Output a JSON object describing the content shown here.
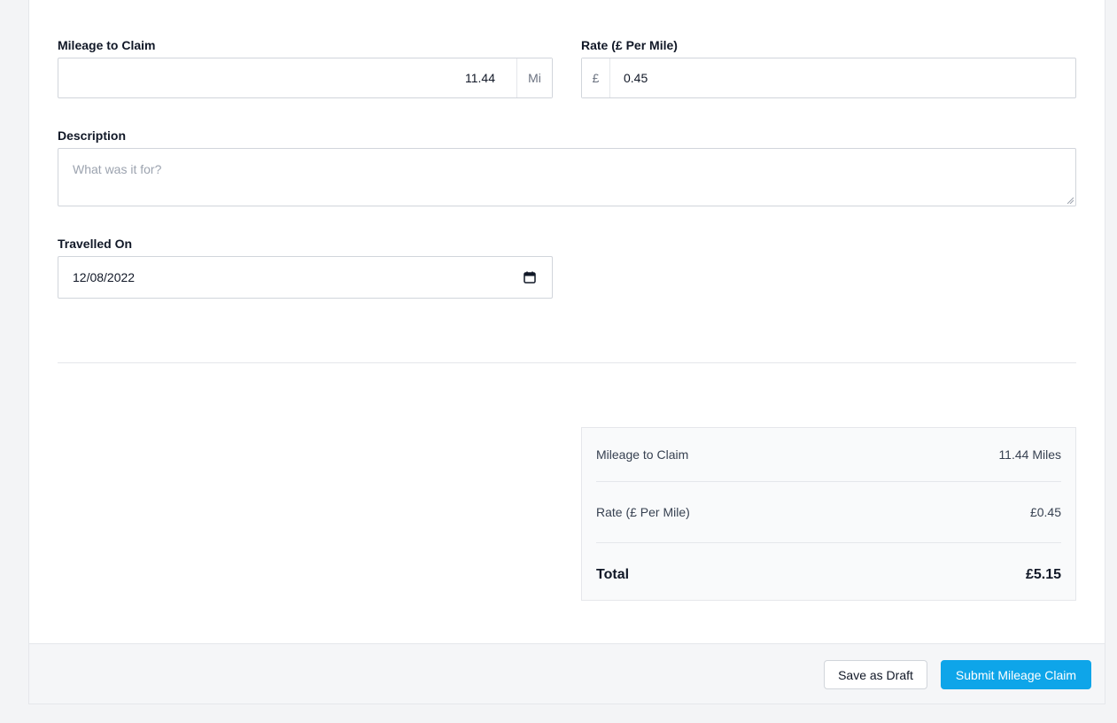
{
  "form": {
    "mileage": {
      "label": "Mileage to Claim",
      "value": "11.44",
      "unit": "Mi"
    },
    "rate": {
      "label": "Rate (£ Per Mile)",
      "prefix": "£",
      "value": "0.45"
    },
    "description": {
      "label": "Description",
      "placeholder": "What was it for?",
      "value": ""
    },
    "travelled_on": {
      "label": "Travelled On",
      "value": "12/08/2022",
      "icon": "calendar-icon"
    }
  },
  "summary": {
    "mileage_label": "Mileage to Claim",
    "mileage_value": "11.44 Miles",
    "rate_label": "Rate (£ Per Mile)",
    "rate_value": "£0.45",
    "total_label": "Total",
    "total_value": "£5.15"
  },
  "footer": {
    "save_draft_label": "Save as Draft",
    "submit_label": "Submit Mileage Claim"
  },
  "colors": {
    "accent": "#0ea5e9",
    "background": "#f3f4f6"
  }
}
